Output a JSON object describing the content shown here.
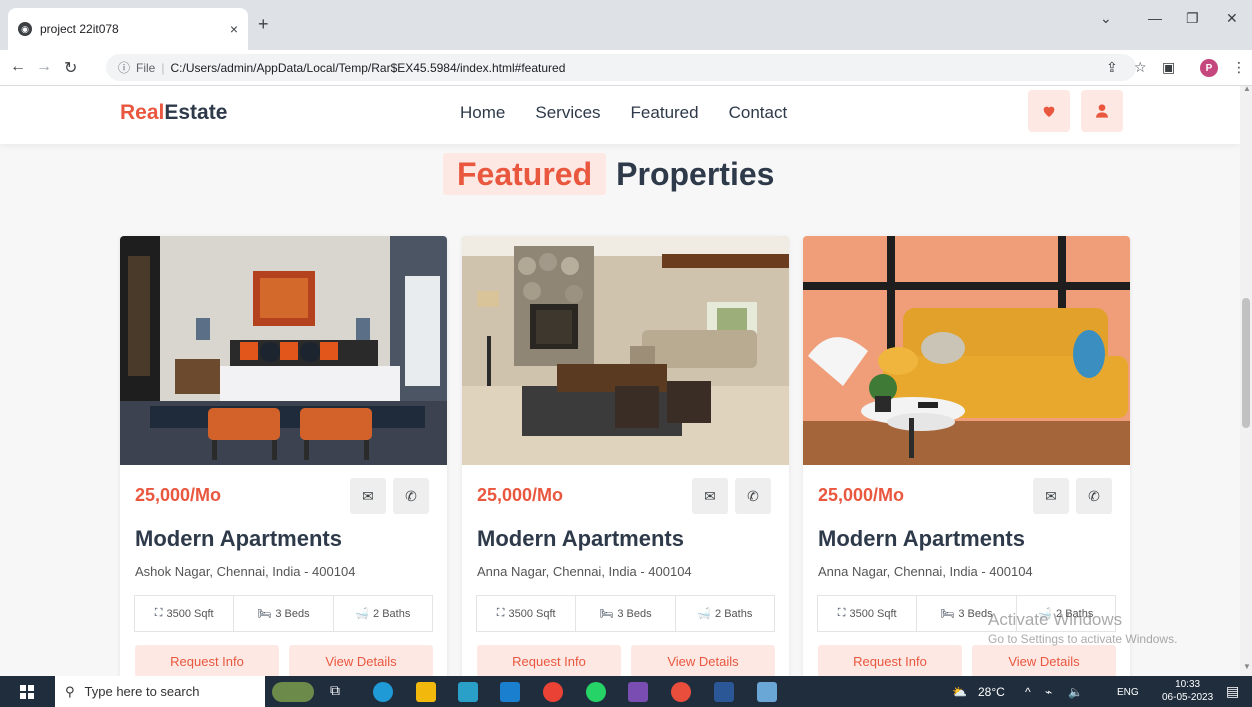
{
  "browser": {
    "tab_title": "project 22it078",
    "tab_close": "×",
    "new_tab": "+",
    "address_prefix": "File",
    "address_url": "C:/Users/admin/AppData/Local/Temp/Rar$EX45.5984/index.html#featured",
    "profile_initial": "P"
  },
  "site": {
    "logo_accent": "Real",
    "logo_rest": "Estate",
    "nav": [
      "Home",
      "Services",
      "Featured",
      "Contact"
    ]
  },
  "section": {
    "title_highlight": "Featured",
    "title_rest": "Properties"
  },
  "cards": [
    {
      "price": "25,000/Mo",
      "name": "Modern Apartments",
      "address": "Ashok Nagar, Chennai, India - 400104",
      "area": "3500 Sqft",
      "beds": "3 Beds",
      "baths": "2 Baths",
      "btn_info": "Request Info",
      "btn_details": "View Details",
      "photo": "bedroom"
    },
    {
      "price": "25,000/Mo",
      "name": "Modern Apartments",
      "address": "Anna Nagar, Chennai, India - 400104",
      "area": "3500 Sqft",
      "beds": "3 Beds",
      "baths": "2 Baths",
      "btn_info": "Request Info",
      "btn_details": "View Details",
      "photo": "living-room-fireplace"
    },
    {
      "price": "25,000/Mo",
      "name": "Modern Apartments",
      "address": "Anna Nagar, Chennai, India - 400104",
      "area": "3500 Sqft",
      "beds": "3 Beds",
      "baths": "2 Baths",
      "btn_info": "Request Info",
      "btn_details": "View Details",
      "photo": "yellow-sofa"
    }
  ],
  "watermark": {
    "line1": "Activate Windows",
    "line2": "Go to Settings to activate Windows."
  },
  "taskbar": {
    "search_placeholder": "Type here to search",
    "weather": "28°C",
    "lang": "ENG",
    "time": "10:33",
    "date": "06-05-2023"
  },
  "colors": {
    "accent": "#e9573f",
    "accent_bg": "#fde8e3",
    "heading": "#2e3a4a"
  }
}
